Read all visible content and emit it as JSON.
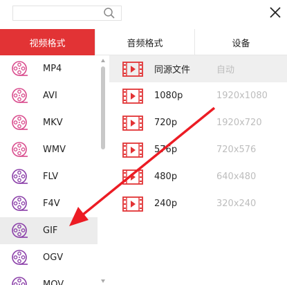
{
  "search": {
    "value": "",
    "placeholder": ""
  },
  "tabs": [
    {
      "label": "视频格式",
      "active": true
    },
    {
      "label": "音频格式",
      "active": false
    },
    {
      "label": "设备",
      "active": false
    }
  ],
  "formats": [
    {
      "label": "MP4"
    },
    {
      "label": "AVI"
    },
    {
      "label": "MKV"
    },
    {
      "label": "WMV"
    },
    {
      "label": "FLV"
    },
    {
      "label": "F4V"
    },
    {
      "label": "GIF"
    },
    {
      "label": "OGV"
    },
    {
      "label": "MOV"
    }
  ],
  "selected_format": "GIF",
  "resolutions": [
    {
      "name": "同源文件",
      "res": "自动"
    },
    {
      "name": "1080p",
      "res": "1920x1080"
    },
    {
      "name": "720p",
      "res": "1920x720"
    },
    {
      "name": "576p",
      "res": "720x576"
    },
    {
      "name": "480p",
      "res": "640x480"
    },
    {
      "name": "240p",
      "res": "320x240"
    }
  ],
  "colors": {
    "accent": "#e23335",
    "pink_icon": "#d94a8c",
    "purple_icon": "#8a3ea8"
  }
}
